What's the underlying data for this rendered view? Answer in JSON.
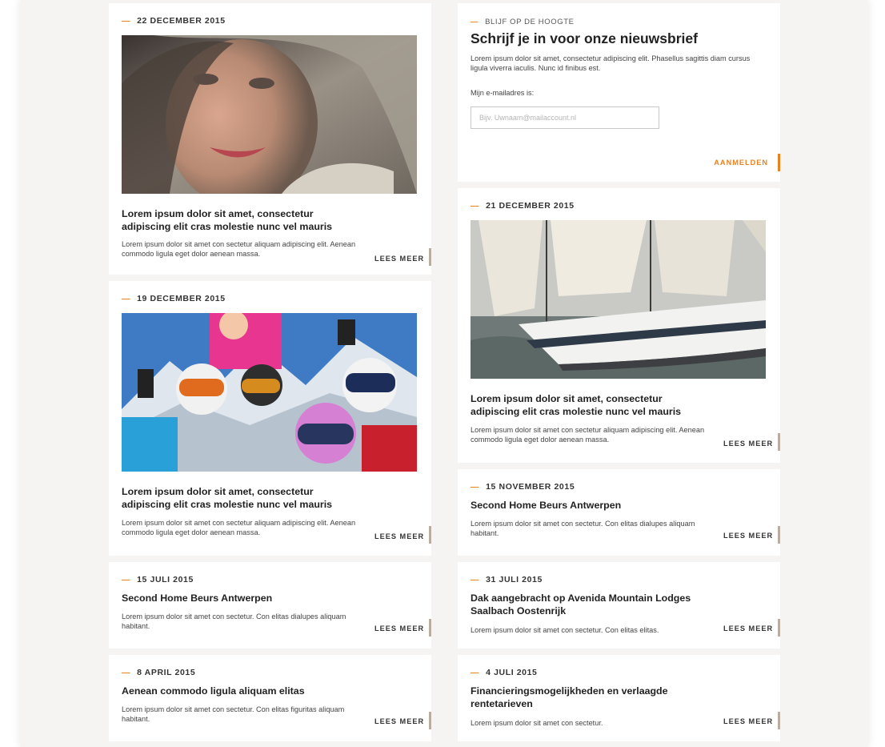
{
  "accent_color": "#e8821e",
  "tick_color": "#b9aca0",
  "newsletter": {
    "kicker": "BLIJF OP DE HOOGTE",
    "title": "Schrijf je in voor onze nieuwsbrief",
    "text": "Lorem ipsum dolor sit amet, consectetur adipiscing elit. Phasellus sagittis diam cursus ligula viverra iaculis. Nunc id finibus est.",
    "email_label": "Mijn e-mailadres is:",
    "email_placeholder": "Bijv. Uwnaam@mailaccount.nl",
    "email_value": "",
    "submit_label": "AANMELDEN"
  },
  "left_column": [
    {
      "date": "22 DECEMBER 2015",
      "image": "portrait-woman-photo",
      "title": "Lorem ipsum dolor sit amet, consectetur adipiscing elit cras molestie nunc vel mauris",
      "text": "Lorem ipsum dolor sit amet con sectetur aliquam adipiscing elit. Aenean commodo ligula eget dolor aenean massa.",
      "more": "LEES MEER"
    },
    {
      "date": "19 DECEMBER 2015",
      "image": "skiing-family-photo",
      "title": "Lorem ipsum dolor sit amet, consectetur adipiscing elit cras molestie nunc vel mauris",
      "text": "Lorem ipsum dolor sit amet con sectetur aliquam adipiscing elit. Aenean commodo ligula eget dolor aenean massa.",
      "more": "LEES MEER"
    },
    {
      "date": "15 JULI 2015",
      "title": "Second Home Beurs Antwerpen",
      "text": "Lorem ipsum dolor sit amet con sectetur. Con elitas dialupes aliquam habitant.",
      "more": "LEES MEER"
    },
    {
      "date": "8 APRIL 2015",
      "title": "Aenean commodo ligula aliquam elitas",
      "text": "Lorem ipsum dolor sit amet con sectetur. Con elitas figuritas aliquam habitant.",
      "more": "LEES MEER"
    }
  ],
  "right_column": [
    {
      "date": "21 DECEMBER 2015",
      "image": "sailing-ship-photo",
      "title": "Lorem ipsum dolor sit amet, consectetur adipiscing elit cras molestie nunc vel mauris",
      "text": "Lorem ipsum dolor sit amet con sectetur aliquam adipiscing elit. Aenean commodo ligula eget dolor aenean massa.",
      "more": "LEES MEER"
    },
    {
      "date": "15 NOVEMBER 2015",
      "title": "Second Home Beurs Antwerpen",
      "text": "Lorem ipsum dolor sit amet con sectetur. Con elitas dialupes aliquam habitant.",
      "more": "LEES MEER"
    },
    {
      "date": "31 JULI 2015",
      "title": "Dak aangebracht op Avenida Mountain Lodges Saalbach Oostenrijk",
      "text": "Lorem ipsum dolor sit amet con sectetur. Con elitas elitas.",
      "more": "LEES MEER"
    },
    {
      "date": "4 JULI 2015",
      "title": "Financieringsmogelijkheden en verlaagde rentetarieven",
      "text": "Lorem ipsum dolor sit amet con sectetur.",
      "more": "LEES MEER"
    }
  ]
}
